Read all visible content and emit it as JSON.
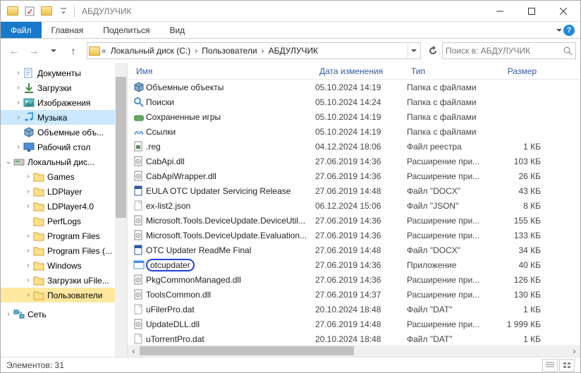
{
  "title": "АБДУЛУЧИК",
  "tabs": {
    "file": "Файл",
    "home": "Главная",
    "share": "Поделиться",
    "view": "Вид"
  },
  "breadcrumbs": [
    "Локальный диск (C:)",
    "Пользователи",
    "АБДУЛУЧИК"
  ],
  "search_placeholder": "Поиск в: АБДУЛУЧИК",
  "columns": {
    "name": "Имя",
    "date": "Дата изменения",
    "type": "Тип",
    "size": "Размер"
  },
  "tree": [
    {
      "label": "Документы",
      "icon": "doc",
      "pad": 1,
      "tw": ">"
    },
    {
      "label": "Загрузки",
      "icon": "down",
      "pad": 1,
      "tw": ">"
    },
    {
      "label": "Изображения",
      "icon": "img",
      "pad": 1,
      "tw": ">"
    },
    {
      "label": "Музыка",
      "icon": "music",
      "pad": 1,
      "tw": ">",
      "sel": true
    },
    {
      "label": "Объемные объ...",
      "icon": "cube",
      "pad": 1,
      "tw": ""
    },
    {
      "label": "Рабочий стол",
      "icon": "desk",
      "pad": 1,
      "tw": ">"
    },
    {
      "label": "Локальный дис...",
      "icon": "disk",
      "pad": 0,
      "tw": "v"
    },
    {
      "label": "Games",
      "icon": "folder",
      "pad": 2,
      "tw": ">"
    },
    {
      "label": "LDPlayer",
      "icon": "folder",
      "pad": 2,
      "tw": ">"
    },
    {
      "label": "LDPlayer4.0",
      "icon": "folder",
      "pad": 2,
      "tw": ">"
    },
    {
      "label": "PerfLogs",
      "icon": "folder",
      "pad": 2,
      "tw": ""
    },
    {
      "label": "Program Files",
      "icon": "folder",
      "pad": 2,
      "tw": ">"
    },
    {
      "label": "Program Files (...",
      "icon": "folder",
      "pad": 2,
      "tw": ">"
    },
    {
      "label": "Windows",
      "icon": "folder",
      "pad": 2,
      "tw": ">"
    },
    {
      "label": "Загрузки uFile...",
      "icon": "folder",
      "pad": 2,
      "tw": ">"
    },
    {
      "label": "Пользователи",
      "icon": "folder",
      "pad": 2,
      "tw": ">",
      "cur": true
    },
    {
      "label": "Сеть",
      "icon": "net",
      "pad": 0,
      "tw": ">"
    }
  ],
  "files": [
    {
      "name": "Объемные объекты",
      "date": "05.10.2024 14:19",
      "type": "Папка с файлами",
      "size": "",
      "icon": "cube"
    },
    {
      "name": "Поиски",
      "date": "05.10.2024 14:24",
      "type": "Папка с файлами",
      "size": "",
      "icon": "search"
    },
    {
      "name": "Сохраненные игры",
      "date": "05.10.2024 14:19",
      "type": "Папка с файлами",
      "size": "",
      "icon": "game"
    },
    {
      "name": "Ссылки",
      "date": "05.10.2024 14:19",
      "type": "Папка с файлами",
      "size": "",
      "icon": "link"
    },
    {
      "name": ".reg",
      "date": "04.12.2024 18:06",
      "type": "Файл реестра",
      "size": "1 КБ",
      "icon": "reg"
    },
    {
      "name": "CabApi.dll",
      "date": "27.06.2019 14:36",
      "type": "Расширение при...",
      "size": "103 КБ",
      "icon": "dll"
    },
    {
      "name": "CabApiWrapper.dll",
      "date": "27.06.2019 14:36",
      "type": "Расширение при...",
      "size": "26 КБ",
      "icon": "dll"
    },
    {
      "name": "EULA OTC Updater Servicing Release",
      "date": "27.06.2019 14:48",
      "type": "Файл \"DOCX\"",
      "size": "43 КБ",
      "icon": "docx"
    },
    {
      "name": "ex-list2.json",
      "date": "06.12.2024 15:06",
      "type": "Файл \"JSON\"",
      "size": "8 КБ",
      "icon": "file"
    },
    {
      "name": "Microsoft.Tools.DeviceUpdate.DeviceUtil...",
      "date": "27.06.2019 14:36",
      "type": "Расширение при...",
      "size": "155 КБ",
      "icon": "dll"
    },
    {
      "name": "Microsoft.Tools.DeviceUpdate.Evaluation...",
      "date": "27.06.2019 14:36",
      "type": "Расширение при...",
      "size": "133 КБ",
      "icon": "dll"
    },
    {
      "name": "OTC Updater ReadMe Final",
      "date": "27.06.2019 14:48",
      "type": "Файл \"DOCX\"",
      "size": "34 КБ",
      "icon": "docx"
    },
    {
      "name": "otcupdater",
      "date": "27.06.2019 14:36",
      "type": "Приложение",
      "size": "40 КБ",
      "icon": "exe",
      "circled": true
    },
    {
      "name": "PkgCommonManaged.dll",
      "date": "27.06.2019 14:36",
      "type": "Расширение при...",
      "size": "126 КБ",
      "icon": "dll"
    },
    {
      "name": "ToolsCommon.dll",
      "date": "27.06.2019 14:37",
      "type": "Расширение при...",
      "size": "130 КБ",
      "icon": "dll"
    },
    {
      "name": "uFilerPro.dat",
      "date": "20.10.2024 18:48",
      "type": "Файл \"DAT\"",
      "size": "1 КБ",
      "icon": "file"
    },
    {
      "name": "UpdateDLL.dll",
      "date": "27.06.2019 14:48",
      "type": "Расширение при...",
      "size": "1 999 КБ",
      "icon": "dll"
    },
    {
      "name": "uTorrentPro.dat",
      "date": "20.10.2024 18:48",
      "type": "Файл \"DAT\"",
      "size": "1 КБ",
      "icon": "file"
    }
  ],
  "status": "Элементов: 31"
}
